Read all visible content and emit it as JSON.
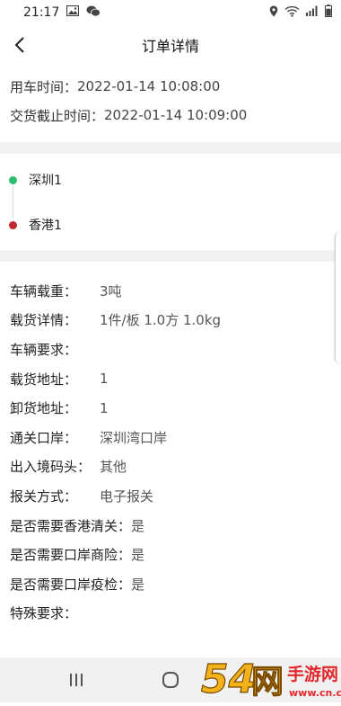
{
  "status_bar": {
    "time": "21:17",
    "battery_percent": 85
  },
  "nav": {
    "title": "订单详情"
  },
  "times": [
    {
      "label": "用车时间：",
      "value": "2022-01-14 10:08:00"
    },
    {
      "label": "交货截止时间：",
      "value": "2022-01-14 10:09:00"
    }
  ],
  "route": {
    "from": {
      "name": "深圳1",
      "color": "#2dbd6e"
    },
    "to": {
      "name": "香港1",
      "color": "#c0282d"
    }
  },
  "details": [
    {
      "label": "车辆载重：",
      "value": "3吨"
    },
    {
      "label": "载货详情：",
      "value": "1件/板  1.0方  1.0kg"
    },
    {
      "label": "车辆要求：",
      "value": ""
    },
    {
      "label": "载货地址：",
      "value": "1"
    },
    {
      "label": "卸货地址：",
      "value": "1"
    },
    {
      "label": "通关口岸：",
      "value": "深圳湾口岸"
    },
    {
      "label": "出入境码头：",
      "value": "其他"
    },
    {
      "label": "报关方式：",
      "value": "电子报关"
    },
    {
      "label": "是否需要香港清关：",
      "value": "是"
    },
    {
      "label": "是否需要口岸商险：",
      "value": "是"
    },
    {
      "label": "是否需要口岸疫检：",
      "value": "是"
    },
    {
      "label": "特殊要求：",
      "value": ""
    }
  ],
  "watermark": {
    "number": "54网",
    "site": "手游网",
    "url": "www.cn.cn"
  }
}
